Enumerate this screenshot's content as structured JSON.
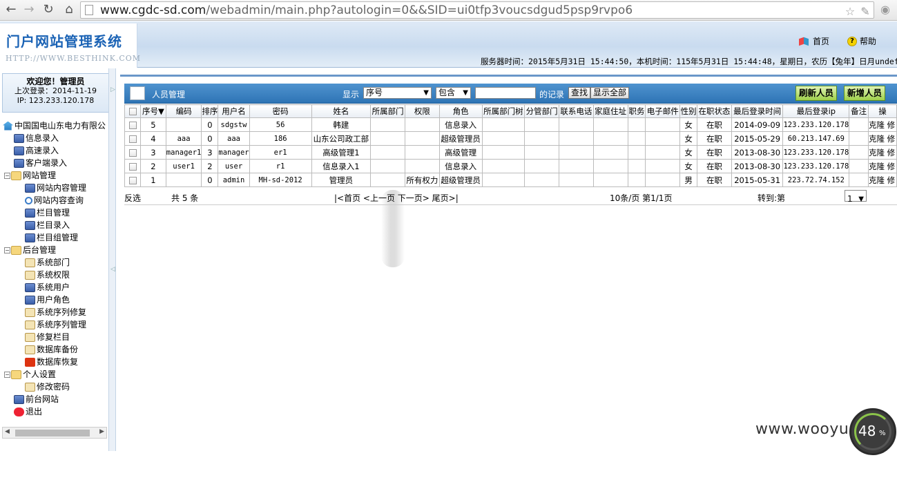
{
  "browser": {
    "url_host": "www.cgdc-sd.com",
    "url_path": "/webadmin/main.php?autologin=0&&SID=ui0tfp3voucsdgud5psp9rvpo6"
  },
  "header": {
    "logo_title": "门户网站管理系统",
    "logo_sub": "HTTP://WWW.BESTHINK.COM",
    "home_label": "首页",
    "help_label": "帮助",
    "server_time": "服务器时间：2015年5月31日 15:44:50，本机时间：115年5月31日 15:44:48，星期日，农历【兔年】日月undefine"
  },
  "welcome": {
    "line1": "欢迎您！管理员",
    "line2": "上次登录：2014-11-19",
    "line3": "IP: 123.233.120.178"
  },
  "tree": {
    "root": "中国国电山东电力有限公",
    "items": [
      "信息录入",
      "高速录入",
      "客户端录入"
    ],
    "site_mgmt": "网站管理",
    "site_items": [
      "网站内容管理",
      "网站内容查询",
      "栏目管理",
      "栏目录入",
      "栏目组管理"
    ],
    "backend": "后台管理",
    "backend_items": [
      "系统部门",
      "系统权限",
      "系统用户",
      "用户角色",
      "系统序列修复",
      "系统序列管理",
      "修复栏目",
      "数据库备份",
      "数据库恢复"
    ],
    "personal": "个人设置",
    "personal_items": [
      "修改密码"
    ],
    "front": "前台网站",
    "exit": "退出"
  },
  "toolbar": {
    "title": "人员管理",
    "show_label": "显示",
    "field_select": "序号",
    "op_select": "包含",
    "search_value": "",
    "records_label": "的记录",
    "find_btn": "查找",
    "show_all_btn": "显示全部",
    "refresh_btn": "刷新人员",
    "add_btn": "新增人员"
  },
  "table": {
    "headers": [
      "",
      "序号▼",
      "编码",
      "排序",
      "用户名",
      "密码",
      "姓名",
      "所属部门",
      "权限",
      "角色",
      "所属部门树",
      "分管部门",
      "联系电话",
      "家庭住址",
      "职务",
      "电子邮件",
      "性别",
      "在职状态",
      "最后登录时间",
      "最后登录ip",
      "备注",
      "操"
    ],
    "rows": [
      [
        "",
        "5",
        "",
        "0",
        "sdgstw",
        "56",
        "韩建",
        "",
        "",
        "信息录入",
        "",
        "",
        "",
        "",
        "",
        "",
        "女",
        "在职",
        "2014-09-09",
        "123.233.120.178",
        "",
        "克隆 修"
      ],
      [
        "",
        "4",
        "aaa",
        "0",
        "aaa",
        "186",
        "山东公司政工部",
        "",
        "",
        "超级管理员",
        "",
        "",
        "",
        "",
        "",
        "",
        "女",
        "在职",
        "2015-05-29",
        "60.213.147.69",
        "",
        "克隆 修"
      ],
      [
        "",
        "3",
        "manager1",
        "3",
        "manager",
        "er1",
        "高级管理1",
        "",
        "",
        "高级管理",
        "",
        "",
        "",
        "",
        "",
        "",
        "女",
        "在职",
        "2013-08-30",
        "123.233.120.178",
        "",
        "克隆 修"
      ],
      [
        "",
        "2",
        "user1",
        "2",
        "user",
        "r1",
        "信息录入1",
        "",
        "",
        "信息录入",
        "",
        "",
        "",
        "",
        "",
        "",
        "女",
        "在职",
        "2013-08-30",
        "123.233.120.178",
        "",
        "克隆 修"
      ],
      [
        "",
        "1",
        "",
        "0",
        "admin",
        "MH-sd-2012",
        "管理员",
        "",
        "所有权力",
        "超级管理员",
        "",
        "",
        "",
        "",
        "",
        "",
        "男",
        "在职",
        "2015-05-31",
        "223.72.74.152",
        "",
        "克隆 修"
      ]
    ]
  },
  "footer": {
    "invert": "反选",
    "total": "共 5 条",
    "pager": "|<首页 <上一页 下一页> 尾页>|",
    "page_info": "10条/页 第1/1页",
    "goto": "转到:第",
    "page_select": "1"
  },
  "overlay": {
    "watermark": "www.wooyu",
    "gauge_num": "48",
    "gauge_pct": "%"
  }
}
